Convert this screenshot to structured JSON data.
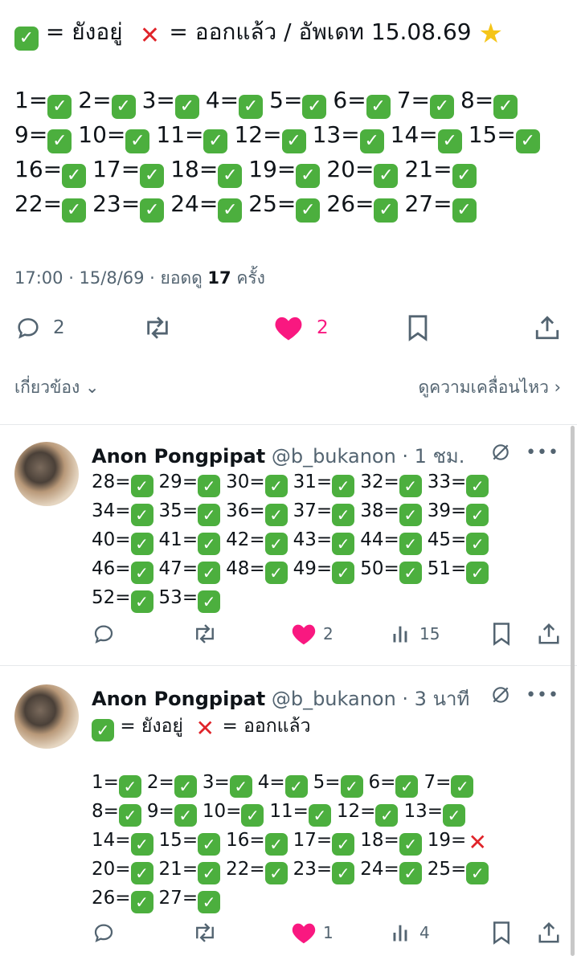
{
  "main": {
    "legend": {
      "check_text": "= ยังอยู่",
      "cross_text": "= ออกแล้ว / อัพเดท 15.08.69"
    },
    "rows": [
      [
        "1=",
        "2=",
        "3=",
        "4=",
        "5=",
        "6=",
        "7=",
        "8="
      ],
      [
        "9=",
        "10=",
        "11=",
        "12=",
        "13=",
        "14=",
        "15="
      ],
      [
        "16=",
        "17=",
        "18=",
        "19=",
        "20=",
        "21="
      ],
      [
        "22=",
        "23=",
        "24=",
        "25=",
        "26=",
        "27="
      ]
    ],
    "meta": {
      "time": "17:00 · 15/8/69 · ยอดดู",
      "views": "17",
      "views_suffix": "ครั้ง"
    },
    "actions": {
      "replies": "2",
      "likes": "2"
    },
    "related_label": "เกี่ยวข้อง",
    "related_link": "ดูความเคลื่อนไหว"
  },
  "replies": [
    {
      "name": "Anon Pongpipat",
      "handle": "@b_bukanon · 1 ชม.",
      "rows": [
        [
          "28=",
          "29=",
          "30=",
          "31=",
          "32=",
          "33="
        ],
        [
          "34=",
          "35=",
          "36=",
          "37=",
          "38=",
          "39="
        ],
        [
          "40=",
          "41=",
          "42=",
          "43=",
          "44=",
          "45="
        ],
        [
          "46=",
          "47=",
          "48=",
          "49=",
          "50=",
          "51="
        ],
        [
          "52=",
          "53="
        ]
      ],
      "likes": "2",
      "views": "15"
    },
    {
      "name": "Anon Pongpipat",
      "handle": "@b_bukanon · 3 นาที",
      "legend": {
        "check_text": "= ยังอยู่",
        "cross_text": "= ออกแล้ว"
      },
      "rows": [
        [
          "1=",
          "2=",
          "3=",
          "4=",
          "5=",
          "6=",
          "7="
        ],
        [
          "8=",
          "9=",
          "10=",
          "11=",
          "12=",
          "13="
        ],
        [
          "14=",
          "15=",
          "16=",
          "17=",
          "18=",
          "19="
        ],
        [
          "20=",
          "21=",
          "22=",
          "23=",
          "24=",
          "25="
        ],
        [
          "26=",
          "27="
        ]
      ],
      "crossed": [
        "19="
      ],
      "likes": "1",
      "views": "4"
    }
  ],
  "colors": {
    "accent_like": "#f91880",
    "check_green": "#4caf3e",
    "cross_red": "#e0242a",
    "muted": "#536471"
  }
}
